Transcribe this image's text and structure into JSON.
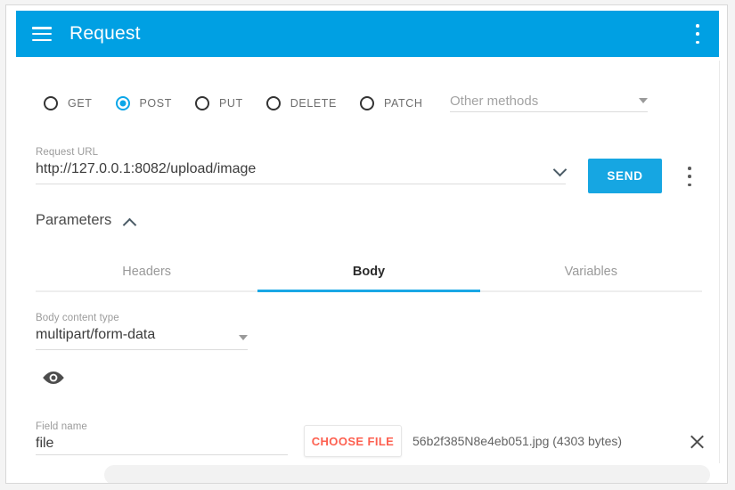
{
  "titlebar": {
    "menu_icon": "hamburger-icon",
    "title": "Request",
    "overflow_icon": "kebab-menu-icon"
  },
  "methods": {
    "options": [
      {
        "label": "GET",
        "selected": false
      },
      {
        "label": "POST",
        "selected": true
      },
      {
        "label": "PUT",
        "selected": false
      },
      {
        "label": "DELETE",
        "selected": false
      },
      {
        "label": "PATCH",
        "selected": false
      }
    ],
    "other_methods_placeholder": "Other methods"
  },
  "url": {
    "label": "Request URL",
    "value": "http://127.0.0.1:8082/upload/image",
    "history_icon": "chevron-down-icon",
    "send_label": "SEND",
    "overflow_icon": "kebab-menu-icon"
  },
  "parameters": {
    "label": "Parameters",
    "collapse_icon": "chevron-up-icon"
  },
  "tabs": [
    {
      "label": "Headers",
      "active": false
    },
    {
      "label": "Body",
      "active": true
    },
    {
      "label": "Variables",
      "active": false
    }
  ],
  "body": {
    "content_type_label": "Body content type",
    "content_type_value": "multipart/form-data",
    "preview_icon": "eye-icon",
    "field_name_label": "Field name",
    "field_name_value": "file",
    "choose_file_label": "CHOOSE FILE",
    "selected_file": "56b2f385N8e4eb051.jpg (4303 bytes)",
    "remove_icon": "close-icon"
  },
  "colors": {
    "brand_blue": "#00a0e3",
    "send_blue": "#16a6e2",
    "tab_underline": "#19a7e5",
    "choose_file_red": "#fd6050"
  }
}
